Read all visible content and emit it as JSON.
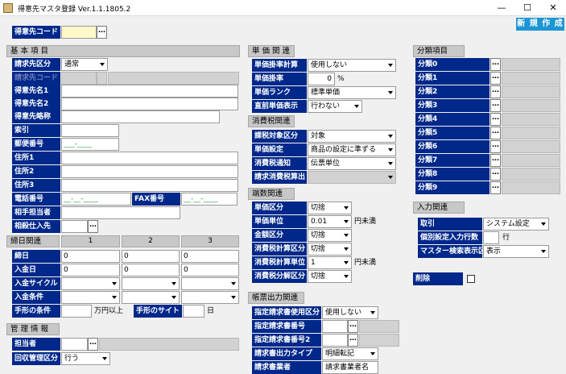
{
  "window": {
    "title": "得意先マスタ登録 Ver.1.1.1805.2",
    "minimize": "—",
    "maximize": "☐",
    "close": "✕"
  },
  "new_button": "新 規 作 成",
  "customer_code": {
    "label": "得意先コード"
  },
  "basic": {
    "title": "基 本 項 目",
    "billing_class": {
      "label": "請求先区分",
      "value": "通常"
    },
    "billing_code": {
      "label": "請求先コード"
    },
    "name1": {
      "label": "得意先名1"
    },
    "name2": {
      "label": "得意先名2"
    },
    "short_name": {
      "label": "得意先略称"
    },
    "index": {
      "label": "索引"
    },
    "zip": {
      "label": "郵便番号",
      "value": "___-____"
    },
    "addr1": {
      "label": "住所1"
    },
    "addr2": {
      "label": "住所2"
    },
    "addr3": {
      "label": "住所3"
    },
    "tel": {
      "label": "電話番号",
      "value": "__-__-____"
    },
    "fax": {
      "label": "FAX番号",
      "value": "__-__-____"
    },
    "contact": {
      "label": "相手担当者"
    },
    "offset": {
      "label": "相殺仕入先"
    }
  },
  "closing": {
    "title": "締日関連",
    "col1": "1",
    "col2": "2",
    "col3": "3",
    "close_day": {
      "label": "締日",
      "v1": "0",
      "v2": "0",
      "v3": "0"
    },
    "pay_day": {
      "label": "入金日",
      "v1": "0",
      "v2": "0",
      "v3": "0"
    },
    "pay_cycle": {
      "label": "入金サイクル"
    },
    "pay_terms": {
      "label": "入金条件"
    },
    "bill_terms": {
      "label": "手形の条件",
      "unit": "万円以上"
    },
    "bill_site": {
      "label": "手形のサイト",
      "unit": "日"
    }
  },
  "mgmt": {
    "title": "管 理 情 報",
    "rep": {
      "label": "担当者"
    },
    "collect": {
      "label": "回収管理区分",
      "value": "行う"
    }
  },
  "price": {
    "title": "単 価 関 連",
    "rate_calc": {
      "label": "単価掛率計算",
      "value": "使用しない"
    },
    "rate": {
      "label": "単価掛率",
      "value": "0",
      "unit": "%"
    },
    "rank": {
      "label": "単価ランク",
      "value": "標準単価"
    },
    "prev_show": {
      "label": "直前単価表示",
      "value": "行わない"
    }
  },
  "tax": {
    "title": "消費税関連",
    "target": {
      "label": "課税対象区分",
      "value": "対象"
    },
    "setting": {
      "label": "単価設定",
      "value": "商品の設定に準ずる"
    },
    "notice": {
      "label": "消費税通知",
      "value": "伝票単位"
    },
    "calc": {
      "label": "請求消費税算出"
    }
  },
  "fraction": {
    "title": "端数関連",
    "unit_price": {
      "label": "単価区分",
      "value": "切捨"
    },
    "unit": {
      "label": "単価単位",
      "value": "0.01",
      "suffix": "円未満"
    },
    "amount": {
      "label": "金額区分",
      "value": "切捨"
    },
    "tax_calc": {
      "label": "消費税計算区分",
      "value": "切捨"
    },
    "tax_unit": {
      "label": "消費税計算単位",
      "value": "1",
      "suffix": "円未満"
    },
    "tax_split": {
      "label": "消費税分解区分",
      "value": "切捨"
    }
  },
  "slip": {
    "title": "帳票出力関連",
    "use_invoice": {
      "label": "指定請求書使用区分",
      "value": "使用しない"
    },
    "inv_no": {
      "label": "指定請求書番号"
    },
    "inv_no2": {
      "label": "指定請求書番号2"
    },
    "out_type": {
      "label": "請求書出力タイプ",
      "value": "明細転記"
    },
    "bottom": {
      "label": "請求書業者",
      "value": "請求書業者名"
    }
  },
  "category": {
    "title": "分類項目",
    "items": [
      "分類0",
      "分類1",
      "分類2",
      "分類3",
      "分類4",
      "分類5",
      "分類6",
      "分類7",
      "分類8",
      "分類9"
    ]
  },
  "input": {
    "title": "入力関連",
    "tori": {
      "label": "取引",
      "value": "システム設定"
    },
    "lines": {
      "label": "個別設定入力行数",
      "unit": "行"
    },
    "search": {
      "label": "マスター検索表示区分",
      "value": "表示"
    }
  },
  "delete": {
    "label": "削除"
  }
}
